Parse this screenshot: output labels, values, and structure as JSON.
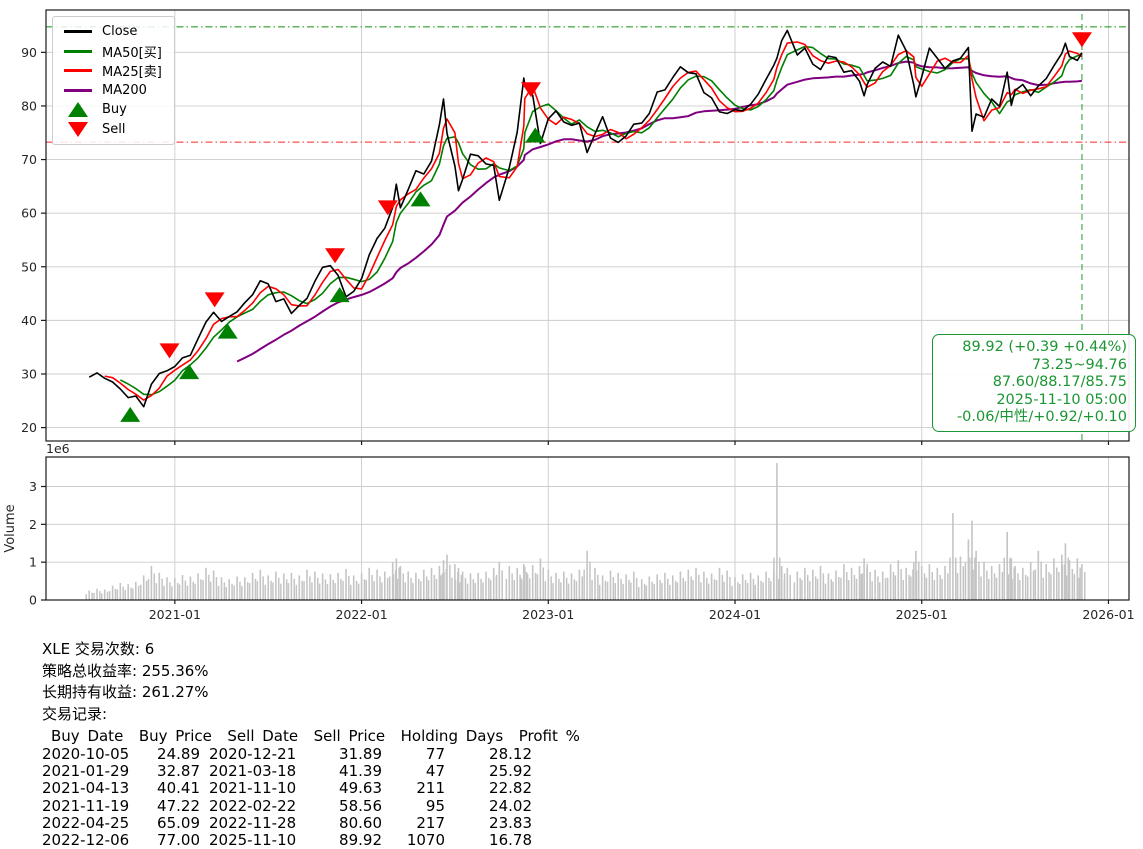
{
  "chart_data": {
    "type": "line",
    "title": "",
    "xlabel": "",
    "ylabel": "",
    "volume_axis_label": "Volume",
    "volume_scale_label": "1e6",
    "x_ticks": [
      "2021-01",
      "2022-01",
      "2023-01",
      "2024-01",
      "2025-01",
      "2026-01"
    ],
    "y_ticks": [
      20,
      30,
      40,
      50,
      60,
      70,
      80,
      90
    ],
    "volume_ticks": [
      0,
      1,
      2,
      3
    ],
    "xlim": [
      2020.31,
      2026.11
    ],
    "ylim": [
      17.5,
      97.9
    ],
    "volume_ylim": [
      0,
      3.78
    ],
    "grid": true,
    "colors": {
      "close": "#000000",
      "ma25": "#ff0000",
      "ma50": "#007f00",
      "ma200": "#800080",
      "buy_marker": "#008000",
      "sell_marker": "#ff0000",
      "hline_high": "rgba(20,150,20,0.75)",
      "hline_low": "rgba(255,30,30,0.7)",
      "vline": "rgba(30,150,40,0.75)",
      "volume_bar": "#c4c4c4",
      "grid_line": "#cccccc",
      "spine": "#1a1a1a",
      "tick_label": "#262626"
    },
    "series_names": {
      "close": "Close",
      "ma50": "MA50[买]",
      "ma25": "MA25[卖]",
      "ma200": "MA200"
    },
    "ma_windows": {
      "ma25": 3,
      "ma50": 5,
      "ma200": 20
    },
    "hlines": [
      {
        "value": 94.76,
        "style": "dashdot",
        "role": "range-high"
      },
      {
        "value": 73.25,
        "style": "dashdot",
        "role": "range-low"
      }
    ],
    "vline": {
      "date": "2025-11-10",
      "style": "dashed"
    },
    "buy_markers": [
      [
        "2020-10-05",
        24.89
      ],
      [
        "2021-01-29",
        32.87
      ],
      [
        "2021-04-13",
        40.41
      ],
      [
        "2021-11-19",
        47.22
      ],
      [
        "2022-04-25",
        65.09
      ],
      [
        "2022-12-06",
        77.0
      ]
    ],
    "sell_markers": [
      [
        "2020-12-21",
        31.89
      ],
      [
        "2021-03-18",
        41.39
      ],
      [
        "2021-11-10",
        49.63
      ],
      [
        "2022-02-22",
        58.56
      ],
      [
        "2022-11-28",
        80.6
      ],
      [
        "2025-11-10",
        89.92
      ]
    ],
    "points_format": [
      "date",
      "close",
      "volume_millions"
    ],
    "points": [
      [
        "2020-07-16",
        29.4,
        0.25
      ],
      [
        "2020-08-01",
        30.2,
        0.3
      ],
      [
        "2020-08-16",
        29.2,
        0.28
      ],
      [
        "2020-09-01",
        28.5,
        0.38
      ],
      [
        "2020-09-16",
        27.2,
        0.45
      ],
      [
        "2020-10-01",
        25.6,
        0.42
      ],
      [
        "2020-10-16",
        25.9,
        0.48
      ],
      [
        "2020-11-01",
        23.9,
        0.65
      ],
      [
        "2020-11-16",
        28.1,
        0.9
      ],
      [
        "2020-12-01",
        30.1,
        0.72
      ],
      [
        "2020-12-16",
        30.6,
        0.6
      ],
      [
        "2021-01-01",
        31.4,
        0.58
      ],
      [
        "2021-01-16",
        33.0,
        0.66
      ],
      [
        "2021-02-01",
        33.5,
        0.62
      ],
      [
        "2021-02-16",
        36.6,
        0.7
      ],
      [
        "2021-03-01",
        39.7,
        0.85
      ],
      [
        "2021-03-16",
        41.5,
        0.78
      ],
      [
        "2021-04-01",
        39.8,
        0.6
      ],
      [
        "2021-04-16",
        40.7,
        0.55
      ],
      [
        "2021-05-01",
        41.6,
        0.62
      ],
      [
        "2021-05-16",
        43.3,
        0.6
      ],
      [
        "2021-06-01",
        44.8,
        0.72
      ],
      [
        "2021-06-16",
        47.4,
        0.8
      ],
      [
        "2021-07-01",
        46.8,
        0.65
      ],
      [
        "2021-07-16",
        43.5,
        0.75
      ],
      [
        "2021-08-01",
        44.0,
        0.7
      ],
      [
        "2021-08-16",
        41.3,
        0.72
      ],
      [
        "2021-09-01",
        42.8,
        0.65
      ],
      [
        "2021-09-16",
        44.1,
        0.8
      ],
      [
        "2021-10-01",
        47.3,
        0.75
      ],
      [
        "2021-10-16",
        49.9,
        0.7
      ],
      [
        "2021-11-01",
        50.2,
        0.68
      ],
      [
        "2021-11-16",
        48.4,
        0.72
      ],
      [
        "2021-12-01",
        44.4,
        0.82
      ],
      [
        "2021-12-16",
        45.4,
        0.65
      ],
      [
        "2022-01-01",
        47.8,
        0.7
      ],
      [
        "2022-01-16",
        52.2,
        0.85
      ],
      [
        "2022-02-01",
        55.3,
        0.8
      ],
      [
        "2022-02-16",
        57.2,
        0.75
      ],
      [
        "2022-03-01",
        61.1,
        1.0
      ],
      [
        "2022-03-08",
        65.4,
        1.1
      ],
      [
        "2022-03-16",
        61.0,
        0.9
      ],
      [
        "2022-04-01",
        64.4,
        0.75
      ],
      [
        "2022-04-16",
        67.9,
        0.72
      ],
      [
        "2022-05-01",
        67.3,
        0.8
      ],
      [
        "2022-05-16",
        69.7,
        0.85
      ],
      [
        "2022-06-01",
        76.5,
        0.9
      ],
      [
        "2022-06-09",
        81.3,
        1.05
      ],
      [
        "2022-06-16",
        74.9,
        1.2
      ],
      [
        "2022-07-01",
        68.8,
        0.95
      ],
      [
        "2022-07-08",
        64.2,
        0.85
      ],
      [
        "2022-07-16",
        66.3,
        0.75
      ],
      [
        "2022-08-01",
        71.0,
        0.7
      ],
      [
        "2022-08-16",
        70.7,
        0.72
      ],
      [
        "2022-09-01",
        69.2,
        0.75
      ],
      [
        "2022-09-16",
        68.9,
        0.85
      ],
      [
        "2022-09-27",
        62.4,
        1.0
      ],
      [
        "2022-10-16",
        68.5,
        0.9
      ],
      [
        "2022-11-01",
        75.1,
        0.85
      ],
      [
        "2022-11-14",
        85.2,
        0.95
      ],
      [
        "2022-11-16",
        83.9,
        0.88
      ],
      [
        "2022-12-01",
        82.0,
        0.92
      ],
      [
        "2022-12-16",
        73.0,
        1.1
      ],
      [
        "2023-01-01",
        77.6,
        0.8
      ],
      [
        "2023-01-16",
        79.1,
        0.72
      ],
      [
        "2023-02-01",
        77.0,
        0.75
      ],
      [
        "2023-02-16",
        76.4,
        0.7
      ],
      [
        "2023-03-01",
        76.8,
        0.8
      ],
      [
        "2023-03-16",
        71.3,
        1.3
      ],
      [
        "2023-04-01",
        74.8,
        0.85
      ],
      [
        "2023-04-16",
        78.0,
        0.65
      ],
      [
        "2023-05-01",
        74.0,
        0.78
      ],
      [
        "2023-05-16",
        73.2,
        0.72
      ],
      [
        "2023-06-01",
        74.4,
        0.68
      ],
      [
        "2023-06-16",
        76.6,
        0.75
      ],
      [
        "2023-07-01",
        76.8,
        0.55
      ],
      [
        "2023-07-16",
        78.6,
        0.62
      ],
      [
        "2023-08-01",
        82.6,
        0.68
      ],
      [
        "2023-08-16",
        83.0,
        0.72
      ],
      [
        "2023-09-01",
        85.3,
        0.65
      ],
      [
        "2023-09-16",
        87.3,
        0.75
      ],
      [
        "2023-10-01",
        86.2,
        0.8
      ],
      [
        "2023-10-16",
        86.0,
        0.85
      ],
      [
        "2023-11-01",
        82.5,
        0.75
      ],
      [
        "2023-11-16",
        81.5,
        0.7
      ],
      [
        "2023-12-01",
        78.9,
        0.85
      ],
      [
        "2023-12-16",
        78.6,
        0.78
      ],
      [
        "2024-01-01",
        79.3,
        0.6
      ],
      [
        "2024-01-16",
        79.1,
        0.68
      ],
      [
        "2024-02-01",
        80.3,
        0.72
      ],
      [
        "2024-02-16",
        82.2,
        0.65
      ],
      [
        "2024-03-01",
        85.0,
        0.75
      ],
      [
        "2024-03-16",
        87.6,
        0.8
      ],
      [
        "2024-03-22",
        88.9,
        3.62
      ],
      [
        "2024-04-01",
        92.2,
        0.9
      ],
      [
        "2024-04-12",
        94.1,
        0.85
      ],
      [
        "2024-05-01",
        89.5,
        0.75
      ],
      [
        "2024-05-16",
        90.8,
        0.85
      ],
      [
        "2024-06-01",
        87.8,
        0.8
      ],
      [
        "2024-06-16",
        86.8,
        0.9
      ],
      [
        "2024-07-01",
        89.3,
        0.7
      ],
      [
        "2024-07-16",
        89.0,
        0.78
      ],
      [
        "2024-08-01",
        86.3,
        0.95
      ],
      [
        "2024-08-16",
        86.6,
        0.85
      ],
      [
        "2024-09-01",
        84.6,
        0.9
      ],
      [
        "2024-09-10",
        81.9,
        1.1
      ],
      [
        "2024-09-16",
        84.0,
        0.95
      ],
      [
        "2024-10-01",
        87.0,
        0.8
      ],
      [
        "2024-10-16",
        88.2,
        0.75
      ],
      [
        "2024-11-01",
        87.4,
        0.95
      ],
      [
        "2024-11-16",
        93.2,
        1.05
      ],
      [
        "2024-12-01",
        90.3,
        0.85
      ],
      [
        "2024-12-16",
        83.9,
        1.0
      ],
      [
        "2024-12-20",
        81.7,
        1.3
      ],
      [
        "2025-01-01",
        85.4,
        0.9
      ],
      [
        "2025-01-16",
        90.8,
        0.95
      ],
      [
        "2025-02-01",
        88.9,
        0.85
      ],
      [
        "2025-02-16",
        87.0,
        0.9
      ],
      [
        "2025-03-01",
        88.4,
        2.3
      ],
      [
        "2025-03-16",
        88.9,
        1.15
      ],
      [
        "2025-04-01",
        90.9,
        1.6
      ],
      [
        "2025-04-08",
        75.3,
        2.1
      ],
      [
        "2025-04-16",
        78.5,
        1.3
      ],
      [
        "2025-05-01",
        77.9,
        1.0
      ],
      [
        "2025-05-16",
        81.3,
        0.9
      ],
      [
        "2025-06-01",
        79.9,
        0.95
      ],
      [
        "2025-06-16",
        86.3,
        1.8
      ],
      [
        "2025-06-24",
        80.1,
        1.1
      ],
      [
        "2025-07-01",
        82.9,
        0.9
      ],
      [
        "2025-07-16",
        84.0,
        0.85
      ],
      [
        "2025-08-01",
        81.9,
        1.0
      ],
      [
        "2025-08-16",
        83.7,
        1.3
      ],
      [
        "2025-09-01",
        85.1,
        0.95
      ],
      [
        "2025-09-16",
        87.5,
        1.1
      ],
      [
        "2025-10-01",
        89.8,
        1.2
      ],
      [
        "2025-10-08",
        91.7,
        1.5
      ],
      [
        "2025-10-16",
        89.2,
        1.05
      ],
      [
        "2025-11-01",
        88.5,
        1.1
      ],
      [
        "2025-11-10",
        89.92,
        0.95
      ]
    ]
  },
  "legend": {
    "items": [
      {
        "label": "Close",
        "color": "#000000",
        "swatch": "line"
      },
      {
        "label": "MA50[买]",
        "color": "#007f00",
        "swatch": "line"
      },
      {
        "label": "MA25[卖]",
        "color": "#ff0000",
        "swatch": "line"
      },
      {
        "label": "MA200",
        "color": "#800080",
        "swatch": "line"
      },
      {
        "label": "Buy",
        "color": "#008000",
        "swatch": "triangle-up"
      },
      {
        "label": "Sell",
        "color": "#ff0000",
        "swatch": "triangle-down"
      }
    ]
  },
  "annotation": {
    "color": "#1c9633",
    "lines": [
      "89.92 (+0.39 +0.44%)",
      "73.25~94.76",
      "87.60/88.17/85.75",
      "2025-11-10 05:00",
      "-0.06/中性/+0.92/+0.10"
    ]
  },
  "summary": {
    "line1": "XLE 交易次数: 6",
    "line2": "策略总收益率: 255.36%",
    "line3": "长期持有收益: 261.27%",
    "line4": "交易记录:"
  },
  "trades": {
    "header": "Buy Date  Buy Price  Sell Date  Sell Price  Holding Days  Profit %",
    "rows": [
      [
        "2020-10-05",
        "24.89",
        "2020-12-21",
        "31.89",
        "77",
        "28.12"
      ],
      [
        "2021-01-29",
        "32.87",
        "2021-03-18",
        "41.39",
        "47",
        "25.92"
      ],
      [
        "2021-04-13",
        "40.41",
        "2021-11-10",
        "49.63",
        "211",
        "22.82"
      ],
      [
        "2021-11-19",
        "47.22",
        "2022-02-22",
        "58.56",
        "95",
        "24.02"
      ],
      [
        "2022-04-25",
        "65.09",
        "2022-11-28",
        "80.60",
        "217",
        "23.83"
      ],
      [
        "2022-12-06",
        "77.00",
        "2025-11-10",
        "89.92",
        "1070",
        "16.78"
      ]
    ]
  }
}
